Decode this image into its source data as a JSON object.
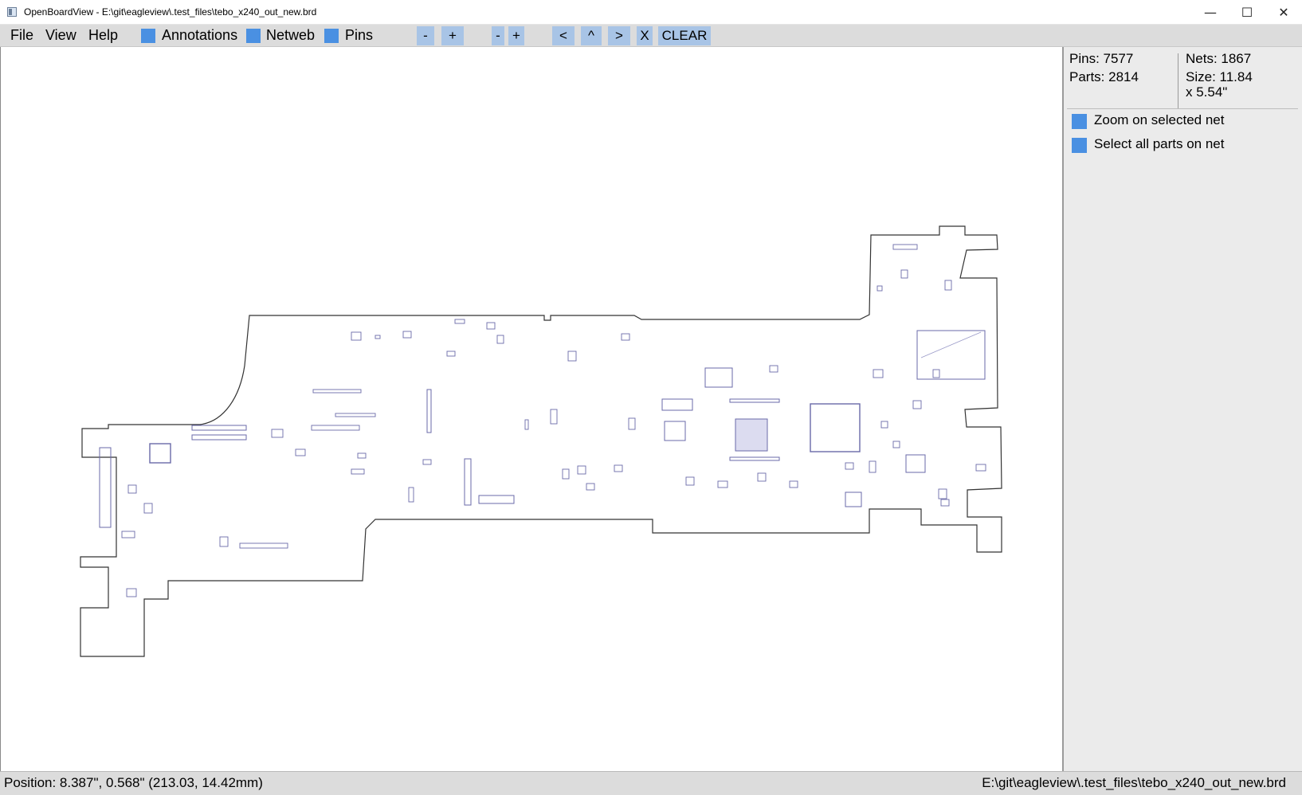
{
  "window": {
    "title": "OpenBoardView - E:\\git\\eagleview\\.test_files\\tebo_x240_out_new.brd",
    "minimize_glyph": "—",
    "maximize_glyph": "☐",
    "close_glyph": "✕"
  },
  "menu": {
    "file": "File",
    "view": "View",
    "help": "Help"
  },
  "toolbar": {
    "annotations_label": "Annotations",
    "netweb_label": "Netweb",
    "pins_label": "Pins",
    "zoom_out_1": "-",
    "zoom_in_1": "+",
    "zoom_out_2": "-",
    "zoom_in_2": "+",
    "pan_left": "<",
    "pan_up": "^",
    "pan_right": ">",
    "close_x": "X",
    "clear": "CLEAR"
  },
  "board_info": {
    "pins": "Pins: 7577",
    "parts": "Parts: 2814",
    "nets": "Nets: 1867",
    "size_line1": "Size: 11.84",
    "size_line2": "x 5.54\""
  },
  "options": {
    "zoom_on_selected_net": "Zoom on selected net",
    "select_all_parts_on_net": "Select all parts on net"
  },
  "status": {
    "position": "Position: 8.387\", 0.568\" (213.03, 14.42mm)",
    "file_path": "E:\\git\\eagleview\\.test_files\\tebo_x240_out_new.brd"
  },
  "colors": {
    "accent_checkbox": "#4a90e2",
    "toolbar_button": "#a8c4e6",
    "board_outline": "#333333",
    "component": "#6a6aa8"
  }
}
